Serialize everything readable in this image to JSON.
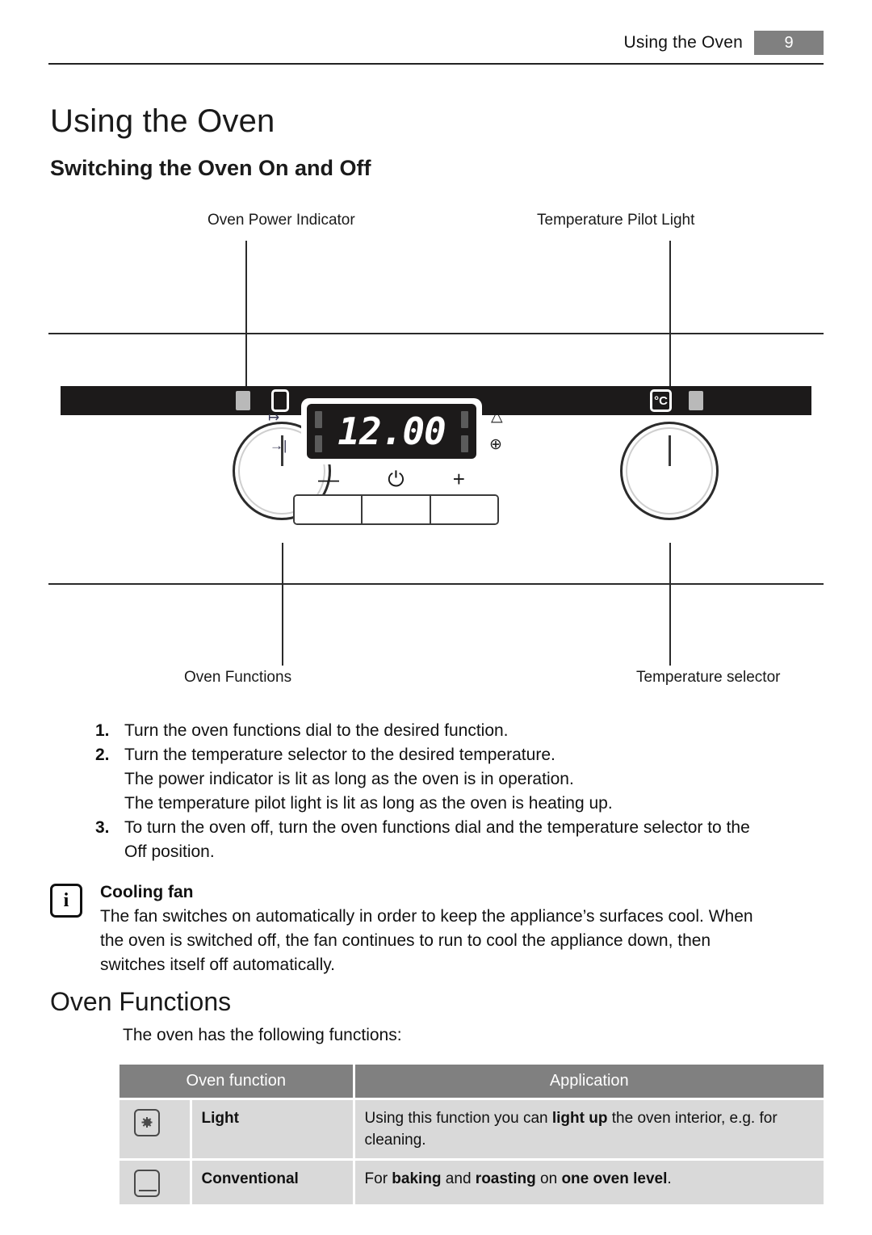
{
  "running_header": {
    "title": "Using the Oven",
    "page_number": "9"
  },
  "headings": {
    "h1": "Using the Oven",
    "section_switching": "Switching the Oven On and Off",
    "section_oven_functions": "Oven Functions"
  },
  "diagram": {
    "labels": {
      "oven_power_indicator": "Oven Power Indicator",
      "temperature_pilot_light": "Temperature Pilot Light",
      "oven_functions": "Oven Functions",
      "temperature_selector": "Temperature selector"
    },
    "display": {
      "digits": "12.00",
      "degc_label": "°C",
      "duration_icon": "↦",
      "end_time_icon": "→|",
      "bell_icon": "△",
      "clock_icon": "⊕"
    },
    "buttons": {
      "minus": "—",
      "clock": "⏻",
      "plus": "+"
    }
  },
  "steps": [
    {
      "number": "1.",
      "lines": [
        "Turn the oven functions dial to the desired function."
      ]
    },
    {
      "number": "2.",
      "lines": [
        "Turn the temperature selector to the desired temperature.",
        "The power indicator is lit as long as the oven is in operation.",
        "The temperature pilot light is lit as long as the oven is heating up."
      ]
    },
    {
      "number": "3.",
      "lines": [
        "To turn the oven off, turn the oven functions dial and the temperature selector to the",
        "Off position."
      ]
    }
  ],
  "note": {
    "icon_letter": "i",
    "title": "Cooling fan",
    "lines": [
      "The fan switches on automatically in order to keep the appliance’s surfaces cool. When",
      "the oven is switched off, the fan continues to run to cool the appliance down, then",
      "switches itself off automatically."
    ]
  },
  "oven_functions": {
    "intro": "The oven has the following functions:",
    "table": {
      "headers": [
        "Oven function",
        "Application"
      ],
      "rows": [
        {
          "icon": "oven-light-icon",
          "name": "Light",
          "application_lines": [
            "Using this function you can light up the oven interior, e.g. for",
            "cleaning."
          ]
        },
        {
          "icon": "conventional-heat-icon",
          "name": "Conventional",
          "application_lines": [
            "For baking and roasting on one oven level."
          ]
        }
      ]
    }
  },
  "colors": {
    "header_gray": "#808080",
    "table_cell_gray": "#d9d9d9",
    "panel_black": "#1c1a1a"
  }
}
